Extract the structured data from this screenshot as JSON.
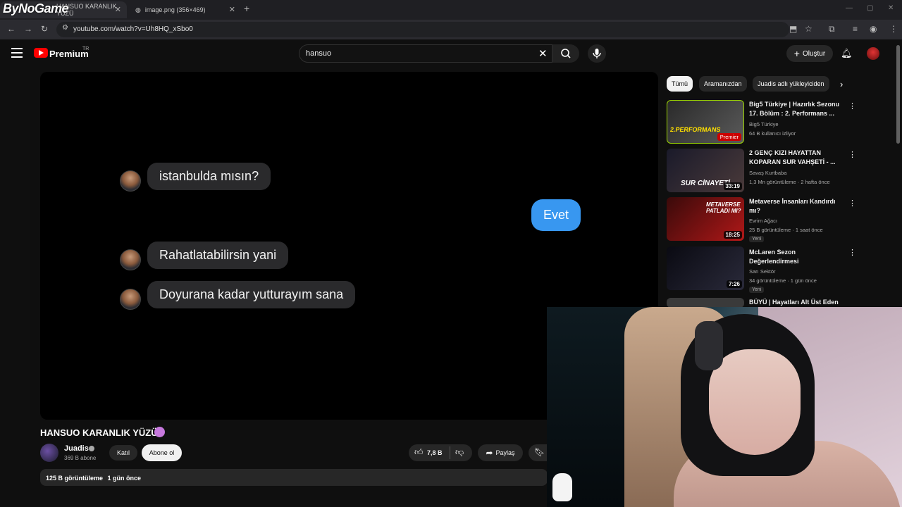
{
  "browser": {
    "watermark": "ByNoGame",
    "tabs": [
      {
        "label": "HANSUO KARANLIK YÜZÜ"
      },
      {
        "label": "image.png (356×469)"
      }
    ],
    "new_tab": "+",
    "url": "youtube.com/watch?v=Uh8HQ_xSbo0"
  },
  "yt_header": {
    "brand": "Premium",
    "region": "TR",
    "search_value": "hansuo",
    "create_label": "Oluştur"
  },
  "video": {
    "messages": [
      {
        "text": "istanbulda mısın?",
        "side": "left"
      },
      {
        "text": "Evet",
        "side": "right"
      },
      {
        "text": "Rahatlatabilirsin yani",
        "side": "left"
      },
      {
        "text": "Doyurana kadar yutturayım sana",
        "side": "left"
      }
    ],
    "title": "HANSUO KARANLIK YÜZÜ",
    "channel": "Juadis",
    "subscribers": "369 B abone",
    "join_label": "Katıl",
    "subscribe_label": "Abone ol",
    "likes": "7,8 B",
    "share_label": "Paylaş",
    "views": "125 B görüntüleme",
    "published": "1 gün önce"
  },
  "sidebar": {
    "chips": [
      "Tümü",
      "Aramanızdan",
      "Juadis adlı yükleyiciden"
    ],
    "recommendations": [
      {
        "title": "Big5 Türkiye | Hazırlık Sezonu 17. Bölüm : 2. Performans ...",
        "channel": "Big5 Türkiye",
        "meta": "64 B kullanıcı izliyor",
        "badge": "Premier",
        "thumb_text": "2.PERFORMANS"
      },
      {
        "title": "2 GENÇ KIZI HAYATTAN KOPARAN SUR VAHŞETİ - ...",
        "channel": "Savaş Kurtbaba",
        "meta": "1,3 Mn görüntüleme · 2 hafta önce",
        "duration": "33:19",
        "thumb_text": "SUR CİNAYETİ"
      },
      {
        "title": "Metaverse İnsanları Kandırdı mı?",
        "channel": "Evrim Ağacı",
        "meta": "25 B görüntüleme · 1 saat önce",
        "duration": "18:25",
        "new": "Yeni",
        "thumb_text": "METAVERSE PATLADI MI?"
      },
      {
        "title": "McLaren Sezon Değerlendirmesi",
        "channel": "Sarı Sektör",
        "meta": "34 görüntüleme · 1 gün önce",
        "duration": "7:26",
        "new": "Yeni"
      },
      {
        "title": "BÜYÜ | Hayatları Alt Üst Eden"
      }
    ]
  },
  "colors": {
    "accent_red": "#ff0000",
    "chat_blue": "#3897f0",
    "chat_gray": "#2a2a2c",
    "bg": "#0f0f0f"
  }
}
